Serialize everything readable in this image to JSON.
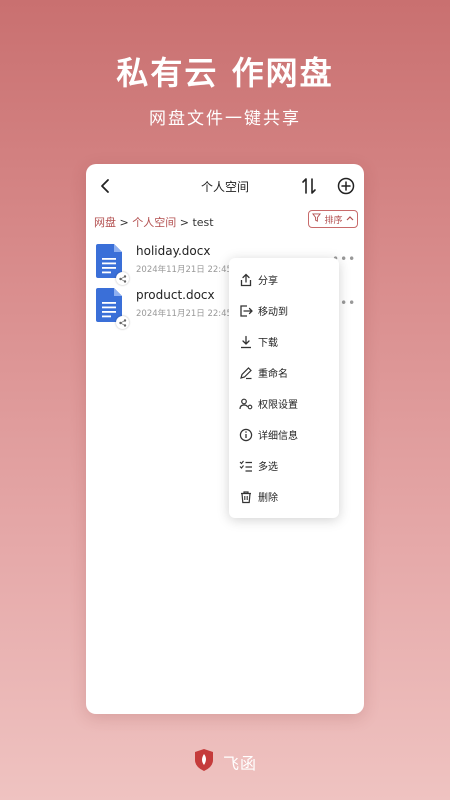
{
  "hero": {
    "title": "私有云 作网盘",
    "subtitle": "网盘文件一键共享"
  },
  "topbar": {
    "title": "个人空间",
    "back_icon": "chevron-left-icon",
    "sort_icon": "sort-arrows-icon",
    "add_icon": "add-circle-icon"
  },
  "breadcrumb": {
    "items": [
      "网盘",
      "个人空间",
      "test"
    ],
    "separator": ">"
  },
  "sort_button": {
    "label": "排序"
  },
  "files": [
    {
      "name": "holiday.docx",
      "date": "2024年11月21日 22:45"
    },
    {
      "name": "product.docx",
      "date": "2024年11月21日 22:45"
    }
  ],
  "context_menu": {
    "items": [
      {
        "label": "分享",
        "icon": "share-icon"
      },
      {
        "label": "移动到",
        "icon": "move-to-icon"
      },
      {
        "label": "下载",
        "icon": "download-icon"
      },
      {
        "label": "重命名",
        "icon": "rename-icon"
      },
      {
        "label": "权限设置",
        "icon": "permission-icon"
      },
      {
        "label": "详细信息",
        "icon": "info-icon"
      },
      {
        "label": "多选",
        "icon": "multi-select-icon"
      },
      {
        "label": "删除",
        "icon": "delete-icon"
      }
    ]
  },
  "brand": {
    "name": "飞函"
  },
  "colors": {
    "accent": "#b35050",
    "doc_blue": "#3a6fd8",
    "background_top": "#c97070",
    "background_bottom": "#efc3c1"
  }
}
